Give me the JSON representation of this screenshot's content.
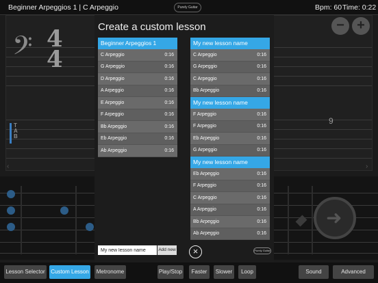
{
  "topbar": {
    "title": "Beginner Arpeggios 1 | C Arpeggio",
    "logo_text": "Purely Guitar",
    "bpm": "Bpm: 60",
    "time": "Time: 0:22"
  },
  "sheet": {
    "clef": "𝄢",
    "time_top": "4",
    "time_bottom": "4",
    "tab_label": "T\nA\nB",
    "fret_number": "9",
    "zoom_out": "−",
    "zoom_in": "+"
  },
  "modal": {
    "title": "Create a custom lesson",
    "source": {
      "header": "Beginner Arpeggios 1",
      "items": [
        {
          "name": "C Arpeggio",
          "dur": "0:16"
        },
        {
          "name": "G Arpeggio",
          "dur": "0:16"
        },
        {
          "name": "D Arpeggio",
          "dur": "0:16"
        },
        {
          "name": "A Arpeggio",
          "dur": "0:16"
        },
        {
          "name": "E Arpeggio",
          "dur": "0:16"
        },
        {
          "name": "F Arpeggio",
          "dur": "0:16"
        },
        {
          "name": "Bb Arpeggio",
          "dur": "0:16"
        },
        {
          "name": "Eb Arpeggio",
          "dur": "0:16"
        },
        {
          "name": "Ab Arpeggio",
          "dur": "0:16"
        }
      ]
    },
    "lessons": [
      {
        "header": "My new lesson name",
        "items": [
          {
            "name": "C Arpeggio",
            "dur": "0:16"
          },
          {
            "name": "G Arpeggio",
            "dur": "0:16"
          },
          {
            "name": "C Arpeggio",
            "dur": "0:16"
          },
          {
            "name": "Bb Arpeggio",
            "dur": "0:16"
          }
        ]
      },
      {
        "header": "My new lesson name",
        "items": [
          {
            "name": "F Arpeggio",
            "dur": "0:16"
          },
          {
            "name": "F Arpeggio",
            "dur": "0:16"
          },
          {
            "name": "Eb Arpeggio",
            "dur": "0:16"
          },
          {
            "name": "G Arpeggio",
            "dur": "0:16"
          }
        ]
      },
      {
        "header": "My new lesson name",
        "items": [
          {
            "name": "Eb Arpeggio",
            "dur": "0:16"
          },
          {
            "name": "F Arpeggio",
            "dur": "0:16"
          },
          {
            "name": "C Arpeggio",
            "dur": "0:16"
          },
          {
            "name": "A Arpeggio",
            "dur": "0:16"
          },
          {
            "name": "Bb Arpeggio",
            "dur": "0:16"
          },
          {
            "name": "Ab Arpeggio",
            "dur": "0:16"
          }
        ]
      }
    ],
    "new_lesson_value": "My new lesson name",
    "add_label": "Add new",
    "close_icon": "close-icon",
    "logo_text": "Purely Guitar"
  },
  "toolbar": {
    "lesson_selector": "Lesson Selector",
    "custom_lesson": "Custom Lesson",
    "metronome": "Metronome",
    "play_stop": "Play/Stop",
    "faster": "Faster",
    "slower": "Slower",
    "loop": "Loop",
    "sound": "Sound",
    "advanced": "Advanced"
  },
  "colors": {
    "accent": "#35a7e6",
    "row": "#6a6a6a",
    "background": "#1b1b1b"
  }
}
